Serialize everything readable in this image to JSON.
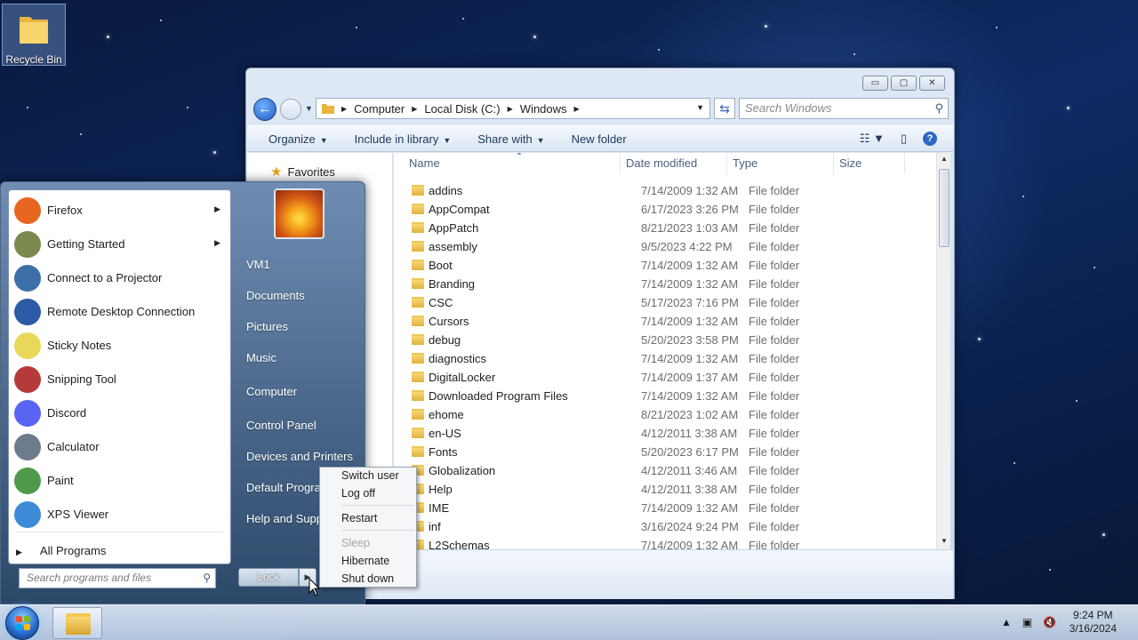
{
  "desktop": {
    "icons": [
      {
        "label": "Recycle Bin",
        "icon": "folder-icon"
      }
    ]
  },
  "explorer": {
    "window_controls": {
      "minimize": "▭",
      "maximize": "▢",
      "close": "✕"
    },
    "address": {
      "crumbs": [
        "Computer",
        "Local Disk (C:)",
        "Windows"
      ]
    },
    "search_placeholder": "Search Windows",
    "toolbar": {
      "organize": "Organize",
      "include_in_library": "Include in library",
      "share_with": "Share with",
      "new_folder": "New folder"
    },
    "nav_pane": {
      "favorites": "Favorites"
    },
    "columns": [
      "Name",
      "Date modified",
      "Type",
      "Size"
    ],
    "files": [
      {
        "name": "addins",
        "date": "7/14/2009 1:32 AM",
        "type": "File folder"
      },
      {
        "name": "AppCompat",
        "date": "6/17/2023 3:26 PM",
        "type": "File folder"
      },
      {
        "name": "AppPatch",
        "date": "8/21/2023 1:03 AM",
        "type": "File folder"
      },
      {
        "name": "assembly",
        "date": "9/5/2023 4:22 PM",
        "type": "File folder"
      },
      {
        "name": "Boot",
        "date": "7/14/2009 1:32 AM",
        "type": "File folder"
      },
      {
        "name": "Branding",
        "date": "7/14/2009 1:32 AM",
        "type": "File folder"
      },
      {
        "name": "CSC",
        "date": "5/17/2023 7:16 PM",
        "type": "File folder"
      },
      {
        "name": "Cursors",
        "date": "7/14/2009 1:32 AM",
        "type": "File folder"
      },
      {
        "name": "debug",
        "date": "5/20/2023 3:58 PM",
        "type": "File folder"
      },
      {
        "name": "diagnostics",
        "date": "7/14/2009 1:32 AM",
        "type": "File folder"
      },
      {
        "name": "DigitalLocker",
        "date": "7/14/2009 1:37 AM",
        "type": "File folder"
      },
      {
        "name": "Downloaded Program Files",
        "date": "7/14/2009 1:32 AM",
        "type": "File folder"
      },
      {
        "name": "ehome",
        "date": "8/21/2023 1:02 AM",
        "type": "File folder"
      },
      {
        "name": "en-US",
        "date": "4/12/2011 3:38 AM",
        "type": "File folder"
      },
      {
        "name": "Fonts",
        "date": "5/20/2023 6:17 PM",
        "type": "File folder"
      },
      {
        "name": "Globalization",
        "date": "4/12/2011 3:46 AM",
        "type": "File folder"
      },
      {
        "name": "Help",
        "date": "4/12/2011 3:38 AM",
        "type": "File folder"
      },
      {
        "name": "IME",
        "date": "7/14/2009 1:32 AM",
        "type": "File folder"
      },
      {
        "name": "inf",
        "date": "3/16/2024 9:24 PM",
        "type": "File folder"
      },
      {
        "name": "L2Schemas",
        "date": "7/14/2009 1:32 AM",
        "type": "File folder"
      }
    ]
  },
  "start_menu": {
    "programs": [
      {
        "label": "Firefox",
        "icon": "firefox-icon",
        "color": "#e8661f",
        "submenu": true
      },
      {
        "label": "Getting Started",
        "icon": "getting-started-icon",
        "color": "#7a8a4e",
        "submenu": true
      },
      {
        "label": "Connect to a Projector",
        "icon": "projector-icon",
        "color": "#3c6ea8",
        "submenu": false
      },
      {
        "label": "Remote Desktop Connection",
        "icon": "remote-desktop-icon",
        "color": "#2a5ba4",
        "submenu": false
      },
      {
        "label": "Sticky Notes",
        "icon": "sticky-notes-icon",
        "color": "#e9d75a",
        "submenu": false
      },
      {
        "label": "Snipping Tool",
        "icon": "scissors-icon",
        "color": "#b73a3a",
        "submenu": false
      },
      {
        "label": "Discord",
        "icon": "discord-icon",
        "color": "#5865f2",
        "submenu": false
      },
      {
        "label": "Calculator",
        "icon": "calculator-icon",
        "color": "#6e7b8c",
        "submenu": false
      },
      {
        "label": "Paint",
        "icon": "paint-icon",
        "color": "#4f9a4a",
        "submenu": false
      },
      {
        "label": "XPS Viewer",
        "icon": "xps-viewer-icon",
        "color": "#3d8bd6",
        "submenu": false
      }
    ],
    "all_programs": "All Programs",
    "search_placeholder": "Search programs and files",
    "right_items": [
      "VM1",
      "Documents",
      "Pictures",
      "Music",
      "Computer",
      "Control Panel",
      "Devices and Printers",
      "Default Programs",
      "Help and Support"
    ],
    "lock_label": "Lock",
    "shutdown_menu": {
      "switch_user": "Switch user",
      "log_off": "Log off",
      "restart": "Restart",
      "sleep": "Sleep",
      "hibernate": "Hibernate",
      "shut_down": "Shut down"
    }
  },
  "taskbar": {
    "clock_time": "9:24 PM",
    "clock_date": "3/16/2024"
  }
}
